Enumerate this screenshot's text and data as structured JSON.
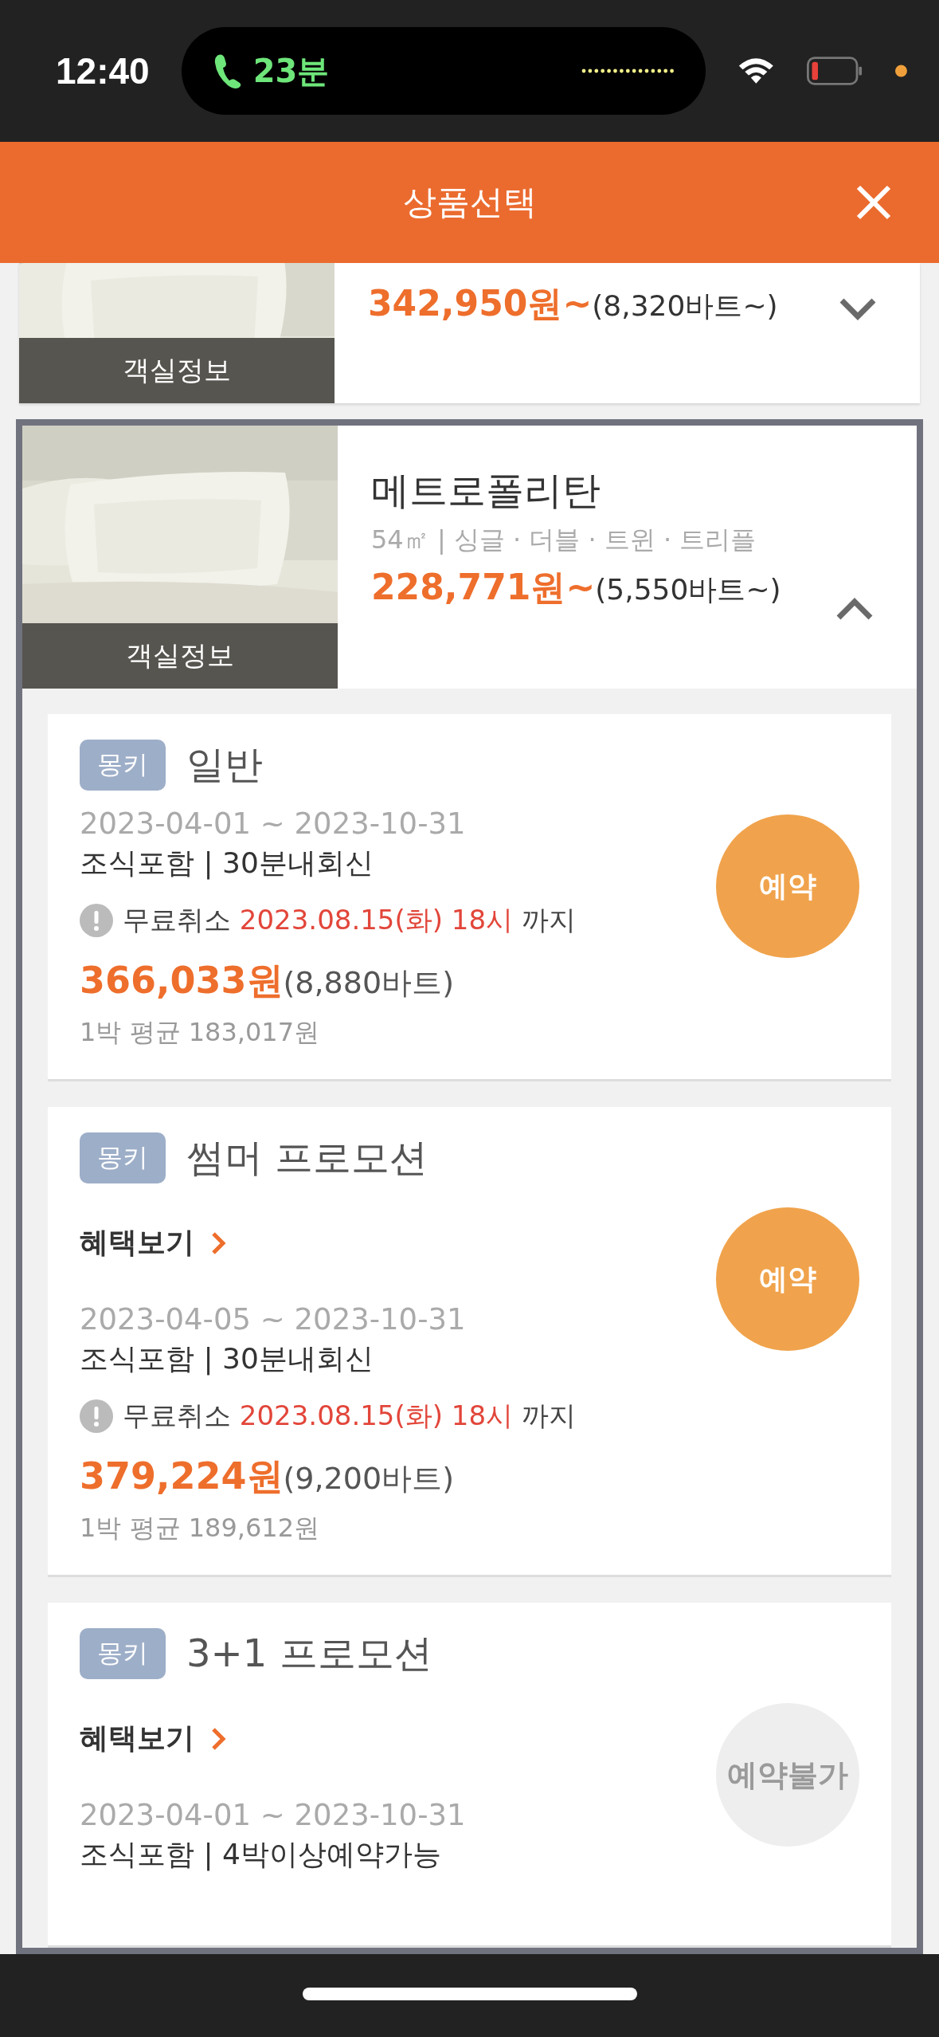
{
  "status_bar": {
    "time": "12:40",
    "call_duration": "23분"
  },
  "header": {
    "title": "상품선택"
  },
  "rooms": [
    {
      "expanded": false,
      "info_label": "객실정보",
      "price": "342,950원~",
      "price_baht": "(8,320바트~)"
    },
    {
      "expanded": true,
      "name": "메트로폴리탄",
      "details": "54㎡ | 싱글 · 더블 · 트윈 · 트리플",
      "info_label": "객실정보",
      "price": "228,771원~",
      "price_baht": "(5,550바트~)",
      "plans": [
        {
          "tag": "몽키",
          "name": "일반",
          "period": "2023-04-01 ~ 2023-10-31",
          "conditions": "조식포함 | 30분내회신",
          "cancel": {
            "label": "무료취소",
            "deadline": "2023.08.15(화) 18시",
            "suffix": "까지"
          },
          "price": "366,033원",
          "price_baht": "(8,880바트)",
          "nightly": "1박 평균 183,017원",
          "button": {
            "label": "예약",
            "disabled": false
          }
        },
        {
          "tag": "몽키",
          "name": "썸머 프로모션",
          "benefits_link": "혜택보기",
          "period": "2023-04-05 ~ 2023-10-31",
          "conditions": "조식포함 | 30분내회신",
          "cancel": {
            "label": "무료취소",
            "deadline": "2023.08.15(화) 18시",
            "suffix": "까지"
          },
          "price": "379,224원",
          "price_baht": "(9,200바트)",
          "nightly": "1박 평균 189,612원",
          "button": {
            "label": "예약",
            "disabled": false
          }
        },
        {
          "tag": "몽키",
          "name": "3+1 프로모션",
          "benefits_link": "혜택보기",
          "period": "2023-04-01 ~ 2023-10-31",
          "conditions": "조식포함 | 4박이상예약가능",
          "button": {
            "label": "예약불가",
            "disabled": true
          }
        }
      ]
    }
  ]
}
